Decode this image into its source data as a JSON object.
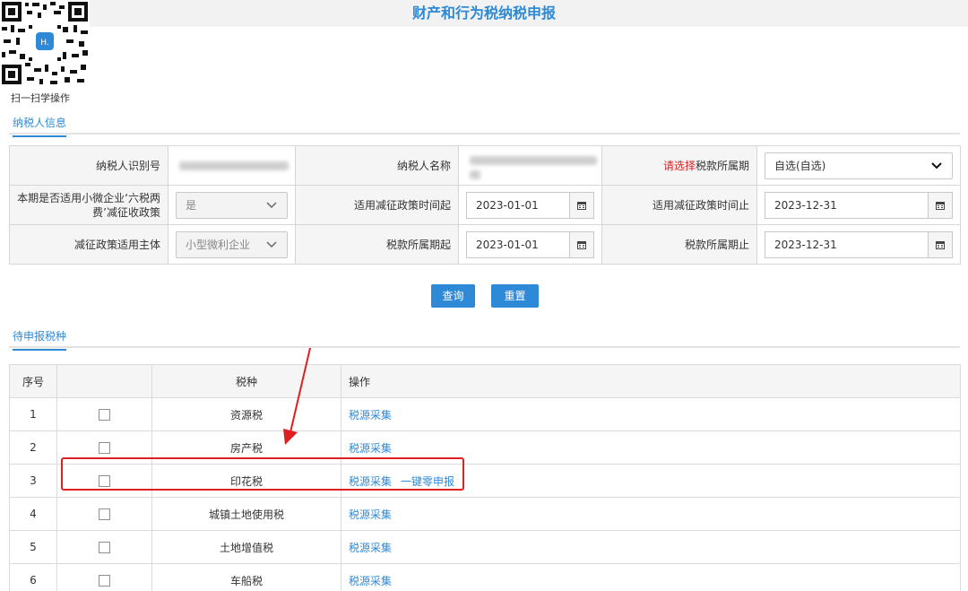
{
  "page_title": "财产和行为税纳税申报",
  "qr_caption": "扫一扫学操作",
  "section_taxpayer": "纳税人信息",
  "section_pending": "待申报税种",
  "form": {
    "taxpayer_id_label": "纳税人识别号",
    "taxpayer_name_label": "纳税人名称",
    "period_label_red": "请选择",
    "period_label_rest": "税款所属期",
    "period_select_value": "自选(自选)",
    "small_micro_label": "本期是否适用小微企业‘六税两费’减征收政策",
    "small_micro_value": "是",
    "policy_start_label": "适用减征政策时间起",
    "policy_start_value": "2023-01-01",
    "policy_end_label": "适用减征政策时间止",
    "policy_end_value": "2023-12-31",
    "subject_label": "减征政策适用主体",
    "subject_value": "小型微利企业",
    "tax_start_label": "税款所属期起",
    "tax_start_value": "2023-01-01",
    "tax_end_label": "税款所属期止",
    "tax_end_value": "2023-12-31"
  },
  "buttons": {
    "query": "查询",
    "reset": "重置"
  },
  "table": {
    "headers": [
      "序号",
      "",
      "税种",
      "操作"
    ],
    "rows": [
      {
        "no": "1",
        "tax": "资源税",
        "ops": [
          "税源采集"
        ]
      },
      {
        "no": "2",
        "tax": "房产税",
        "ops": [
          "税源采集"
        ]
      },
      {
        "no": "3",
        "tax": "印花税",
        "ops": [
          "税源采集",
          "一键零申报"
        ]
      },
      {
        "no": "4",
        "tax": "城镇土地使用税",
        "ops": [
          "税源采集"
        ]
      },
      {
        "no": "5",
        "tax": "土地增值税",
        "ops": [
          "税源采集"
        ]
      },
      {
        "no": "6",
        "tax": "车船税",
        "ops": [
          "税源采集"
        ]
      }
    ]
  },
  "colors": {
    "accent": "#2e8ad6",
    "annotation": "#e02020"
  }
}
